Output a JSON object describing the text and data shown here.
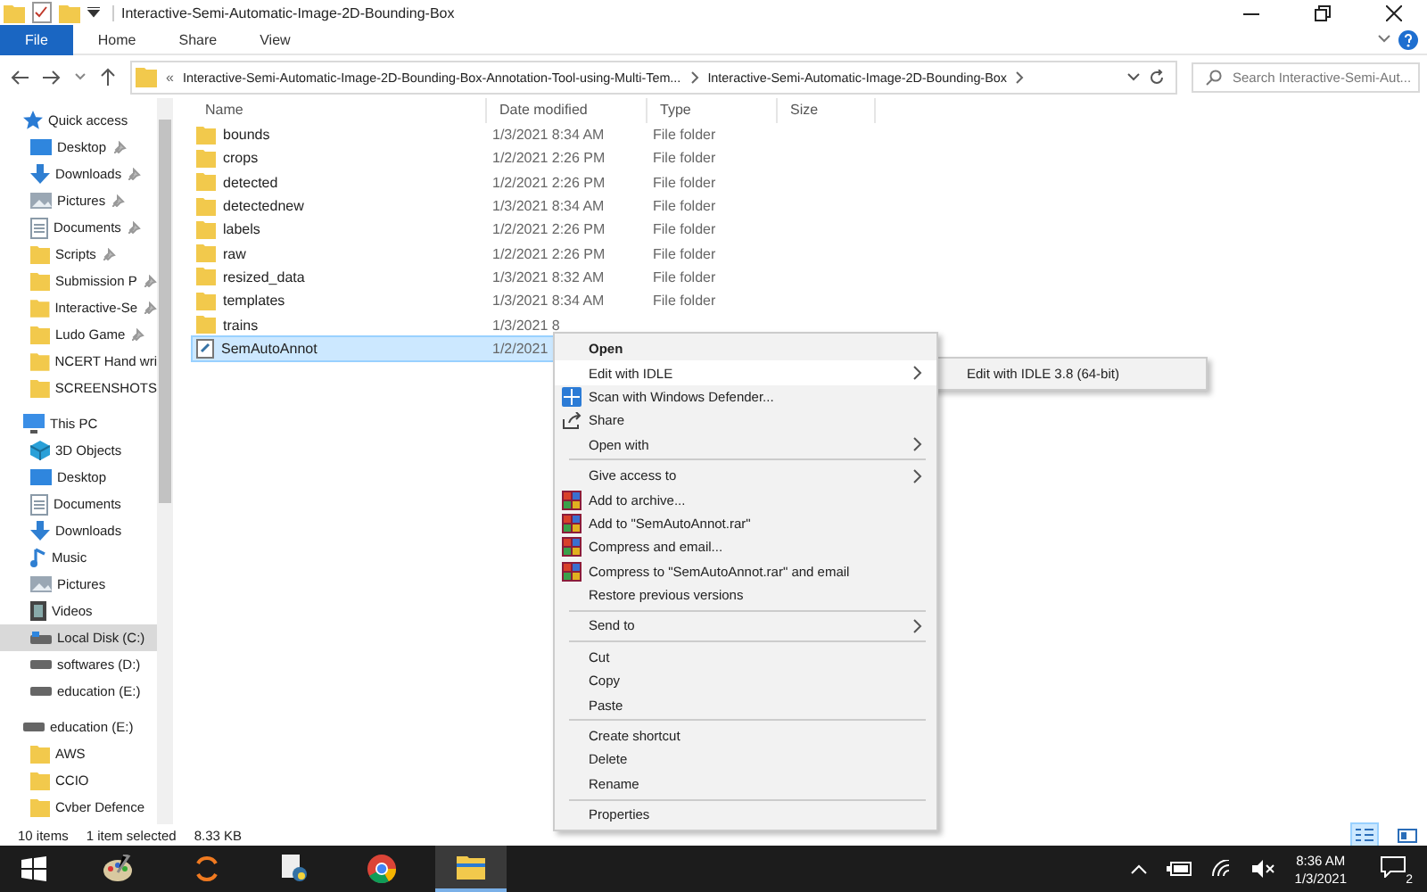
{
  "window": {
    "title": "Interactive-Semi-Automatic-Image-2D-Bounding-Box"
  },
  "ribbon_tabs": [
    {
      "label": "File",
      "selected": true
    },
    {
      "label": "Home",
      "selected": false
    },
    {
      "label": "Share",
      "selected": false
    },
    {
      "label": "View",
      "selected": false
    }
  ],
  "address": {
    "overflow": "«",
    "crumbs": [
      "Interactive-Semi-Automatic-Image-2D-Bounding-Box-Annotation-Tool-using-Multi-Tem...",
      "Interactive-Semi-Automatic-Image-2D-Bounding-Box"
    ]
  },
  "search": {
    "placeholder": "Search Interactive-Semi-Aut..."
  },
  "sidebar": [
    {
      "label": "Quick access",
      "kind": "star",
      "selected": false,
      "children": [
        {
          "label": "Desktop",
          "kind": "desktop",
          "pinned": true,
          "selected": false
        },
        {
          "label": "Downloads",
          "kind": "download",
          "pinned": true,
          "selected": false
        },
        {
          "label": "Pictures",
          "kind": "pictures",
          "pinned": true,
          "selected": false
        },
        {
          "label": "Documents",
          "kind": "documents",
          "pinned": true,
          "selected": false
        },
        {
          "label": "Scripts",
          "kind": "folder",
          "pinned": true,
          "selected": false
        },
        {
          "label": "Submission P",
          "kind": "folder",
          "pinned": true,
          "selected": false
        },
        {
          "label": "Interactive-Se",
          "kind": "folder",
          "pinned": true,
          "selected": false
        },
        {
          "label": "Ludo Game",
          "kind": "folder",
          "pinned": true,
          "selected": false
        },
        {
          "label": "NCERT Hand wri",
          "kind": "folder",
          "pinned": false,
          "selected": false
        },
        {
          "label": "SCREENSHOTS",
          "kind": "folder",
          "pinned": false,
          "selected": false
        }
      ]
    },
    {
      "label": "This PC",
      "kind": "pc",
      "selected": false,
      "children": [
        {
          "label": "3D Objects",
          "kind": "objects",
          "pinned": false,
          "selected": false
        },
        {
          "label": "Desktop",
          "kind": "desktop",
          "pinned": false,
          "selected": false
        },
        {
          "label": "Documents",
          "kind": "documents",
          "pinned": false,
          "selected": false
        },
        {
          "label": "Downloads",
          "kind": "download",
          "pinned": false,
          "selected": false
        },
        {
          "label": "Music",
          "kind": "music",
          "pinned": false,
          "selected": false
        },
        {
          "label": "Pictures",
          "kind": "pictures",
          "pinned": false,
          "selected": false
        },
        {
          "label": "Videos",
          "kind": "videos",
          "pinned": false,
          "selected": false
        },
        {
          "label": "Local Disk (C:)",
          "kind": "disk",
          "pinned": false,
          "selected": true
        },
        {
          "label": "softwares (D:)",
          "kind": "drive",
          "pinned": false,
          "selected": false
        },
        {
          "label": "education (E:)",
          "kind": "drive",
          "pinned": false,
          "selected": false
        }
      ]
    },
    {
      "label": "education (E:)",
      "kind": "drive",
      "selected": false,
      "children": [
        {
          "label": "AWS",
          "kind": "folder",
          "pinned": false,
          "selected": false
        },
        {
          "label": "CCIO",
          "kind": "folder",
          "pinned": false,
          "selected": false
        },
        {
          "label": "Cvber Defence",
          "kind": "folder",
          "pinned": false,
          "selected": false
        }
      ]
    }
  ],
  "table": {
    "columns": [
      "Name",
      "Date modified",
      "Type",
      "Size"
    ],
    "rows": [
      {
        "name": "bounds",
        "date": "1/3/2021 8:34 AM",
        "type": "File folder",
        "kind": "folder",
        "selected": false
      },
      {
        "name": "crops",
        "date": "1/2/2021 2:26 PM",
        "type": "File folder",
        "kind": "folder",
        "selected": false
      },
      {
        "name": "detected",
        "date": "1/2/2021 2:26 PM",
        "type": "File folder",
        "kind": "folder",
        "selected": false
      },
      {
        "name": "detectednew",
        "date": "1/3/2021 8:34 AM",
        "type": "File folder",
        "kind": "folder",
        "selected": false
      },
      {
        "name": "labels",
        "date": "1/2/2021 2:26 PM",
        "type": "File folder",
        "kind": "folder",
        "selected": false
      },
      {
        "name": "raw",
        "date": "1/2/2021 2:26 PM",
        "type": "File folder",
        "kind": "folder",
        "selected": false
      },
      {
        "name": "resized_data",
        "date": "1/3/2021 8:32 AM",
        "type": "File folder",
        "kind": "folder",
        "selected": false
      },
      {
        "name": "templates",
        "date": "1/3/2021 8:34 AM",
        "type": "File folder",
        "kind": "folder",
        "selected": false
      },
      {
        "name": "trains",
        "date": "1/3/2021 8",
        "kind": "folder",
        "selected": false
      },
      {
        "name": "SemAutoAnnot",
        "date": "1/2/2021",
        "kind": "script",
        "selected": true
      }
    ]
  },
  "context_menu": {
    "groups": [
      [
        {
          "label": "Open",
          "kind": "plain",
          "default": true,
          "selected": false,
          "submenu": false
        },
        {
          "label": "Edit with IDLE",
          "kind": "plain",
          "default": false,
          "selected": true,
          "submenu": true
        },
        {
          "label": "Scan with Windows Defender...",
          "kind": "defender",
          "default": false,
          "selected": false,
          "submenu": false
        },
        {
          "label": "Share",
          "kind": "share",
          "default": false,
          "selected": false,
          "submenu": false
        },
        {
          "label": "Open with",
          "kind": "plain",
          "default": false,
          "selected": false,
          "submenu": true
        }
      ],
      [
        {
          "label": "Give access to",
          "kind": "plain",
          "default": false,
          "selected": false,
          "submenu": true
        },
        {
          "label": "Add to archive...",
          "kind": "archive",
          "default": false,
          "selected": false,
          "submenu": false
        },
        {
          "label": "Add to \"SemAutoAnnot.rar\"",
          "kind": "archive",
          "default": false,
          "selected": false,
          "submenu": false
        },
        {
          "label": "Compress and email...",
          "kind": "archive",
          "default": false,
          "selected": false,
          "submenu": false
        },
        {
          "label": "Compress to \"SemAutoAnnot.rar\" and email",
          "kind": "archive",
          "default": false,
          "selected": false,
          "submenu": false
        },
        {
          "label": "Restore previous versions",
          "kind": "plain",
          "default": false,
          "selected": false,
          "submenu": false
        }
      ],
      [
        {
          "label": "Send to",
          "kind": "plain",
          "default": false,
          "selected": false,
          "submenu": true
        }
      ],
      [
        {
          "label": "Cut",
          "kind": "plain",
          "default": false,
          "selected": false,
          "submenu": false
        },
        {
          "label": "Copy",
          "kind": "plain",
          "default": false,
          "selected": false,
          "submenu": false
        },
        {
          "label": "Paste",
          "kind": "plain",
          "default": false,
          "selected": false,
          "submenu": false
        }
      ],
      [
        {
          "label": "Create shortcut",
          "kind": "plain",
          "default": false,
          "selected": false,
          "submenu": false
        },
        {
          "label": "Delete",
          "kind": "plain",
          "default": false,
          "selected": false,
          "submenu": false
        },
        {
          "label": "Rename",
          "kind": "plain",
          "default": false,
          "selected": false,
          "submenu": false
        }
      ],
      [
        {
          "label": "Properties",
          "kind": "plain",
          "default": false,
          "selected": false,
          "submenu": false
        }
      ]
    ],
    "submenu": [
      "Edit with IDLE 3.8 (64-bit)"
    ]
  },
  "status_bar": {
    "count": "10 items",
    "selection": "1 item selected",
    "size": "8.33 KB"
  },
  "taskbar": {
    "time": "8:36 AM",
    "date": "1/3/2021",
    "notifications": "2"
  }
}
